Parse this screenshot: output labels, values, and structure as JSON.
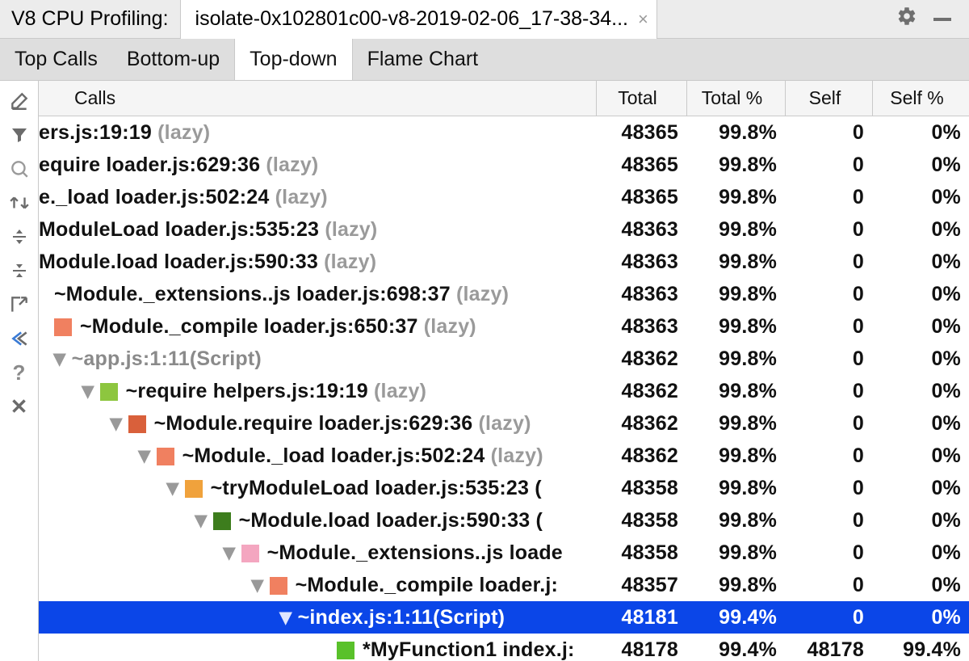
{
  "topbar": {
    "title": "V8 CPU Profiling:",
    "file_name": "isolate-0x102801c00-v8-2019-02-06_17-38-34...",
    "close_glyph": "×"
  },
  "tabs": {
    "items": [
      {
        "label": "Top Calls"
      },
      {
        "label": "Bottom-up"
      },
      {
        "label": "Top-down"
      },
      {
        "label": "Flame Chart"
      }
    ],
    "active_index": 2
  },
  "columns": {
    "calls": "Calls",
    "total": "Total",
    "total_pct": "Total %",
    "self": "Self",
    "self_pct": "Self %"
  },
  "rows": [
    {
      "indent": 0,
      "chev": false,
      "sq": null,
      "parts": [
        {
          "t": "ers.js:19:19 "
        },
        {
          "t": "(lazy)",
          "cls": "lazy"
        }
      ],
      "total": "48365",
      "totalp": "99.8%",
      "self": "0",
      "selfp": "0%"
    },
    {
      "indent": 0,
      "chev": false,
      "sq": null,
      "parts": [
        {
          "t": "equire loader.js:629:36 "
        },
        {
          "t": "(lazy)",
          "cls": "lazy"
        }
      ],
      "total": "48365",
      "totalp": "99.8%",
      "self": "0",
      "selfp": "0%"
    },
    {
      "indent": 0,
      "chev": false,
      "sq": null,
      "parts": [
        {
          "t": "e._load loader.js:502:24 "
        },
        {
          "t": "(lazy)",
          "cls": "lazy"
        }
      ],
      "total": "48365",
      "totalp": "99.8%",
      "self": "0",
      "selfp": "0%"
    },
    {
      "indent": 0,
      "chev": false,
      "sq": null,
      "parts": [
        {
          "t": "ModuleLoad loader.js:535:23 "
        },
        {
          "t": "(lazy)",
          "cls": "lazy"
        }
      ],
      "total": "48363",
      "totalp": "99.8%",
      "self": "0",
      "selfp": "0%"
    },
    {
      "indent": 0,
      "chev": false,
      "sq": null,
      "parts": [
        {
          "t": "Module.load loader.js:590:33 "
        },
        {
          "t": "(lazy)",
          "cls": "lazy"
        }
      ],
      "total": "48363",
      "totalp": "99.8%",
      "self": "0",
      "selfp": "0%"
    },
    {
      "indent": 19,
      "chev": false,
      "sq": null,
      "parts": [
        {
          "t": "~Module._extensions..js loader.js:698:37 "
        },
        {
          "t": "(lazy)",
          "cls": "lazy"
        }
      ],
      "total": "48363",
      "totalp": "99.8%",
      "self": "0",
      "selfp": "0%"
    },
    {
      "indent": 19,
      "chev": false,
      "sq": "#f08060",
      "parts": [
        {
          "t": "~Module._compile loader.js:650:37 "
        },
        {
          "t": "(lazy)",
          "cls": "lazy"
        }
      ],
      "total": "48363",
      "totalp": "99.8%",
      "self": "0",
      "selfp": "0%"
    },
    {
      "indent": 19,
      "chev": true,
      "sq": null,
      "parts": [
        {
          "t": "~app.js:1:11",
          "cls": "gray"
        },
        {
          "t": "(Script)",
          "cls": "gray"
        }
      ],
      "total": "48362",
      "totalp": "99.8%",
      "self": "0",
      "selfp": "0%"
    },
    {
      "indent": 54,
      "chev": true,
      "sq": "#8dc63f",
      "parts": [
        {
          "t": "~require helpers.js:19:19 "
        },
        {
          "t": "(lazy)",
          "cls": "lazy"
        }
      ],
      "total": "48362",
      "totalp": "99.8%",
      "self": "0",
      "selfp": "0%"
    },
    {
      "indent": 89,
      "chev": true,
      "sq": "#d9603b",
      "parts": [
        {
          "t": "~Module.require loader.js:629:36 "
        },
        {
          "t": "(lazy)",
          "cls": "lazy"
        }
      ],
      "total": "48362",
      "totalp": "99.8%",
      "self": "0",
      "selfp": "0%"
    },
    {
      "indent": 124,
      "chev": true,
      "sq": "#f08060",
      "parts": [
        {
          "t": "~Module._load loader.js:502:24 "
        },
        {
          "t": "(lazy)",
          "cls": "lazy"
        }
      ],
      "total": "48362",
      "totalp": "99.8%",
      "self": "0",
      "selfp": "0%"
    },
    {
      "indent": 159,
      "chev": true,
      "sq": "#f0a23c",
      "parts": [
        {
          "t": "~tryModuleLoad loader.js:535:23 ("
        }
      ],
      "total": "48358",
      "totalp": "99.8%",
      "self": "0",
      "selfp": "0%"
    },
    {
      "indent": 194,
      "chev": true,
      "sq": "#3d7d1d",
      "parts": [
        {
          "t": "~Module.load loader.js:590:33 ("
        }
      ],
      "total": "48358",
      "totalp": "99.8%",
      "self": "0",
      "selfp": "0%"
    },
    {
      "indent": 229,
      "chev": true,
      "sq": "#f4a6c0",
      "parts": [
        {
          "t": "~Module._extensions..js loade"
        }
      ],
      "total": "48358",
      "totalp": "99.8%",
      "self": "0",
      "selfp": "0%"
    },
    {
      "indent": 264,
      "chev": true,
      "sq": "#f08060",
      "parts": [
        {
          "t": "~Module._compile loader.j:"
        }
      ],
      "total": "48357",
      "totalp": "99.8%",
      "self": "0",
      "selfp": "0%"
    },
    {
      "indent": 299,
      "chev": true,
      "sq": null,
      "parts": [
        {
          "t": "~index.js:1:11(Script)"
        }
      ],
      "selected": true,
      "total": "48181",
      "totalp": "99.4%",
      "self": "0",
      "selfp": "0%"
    },
    {
      "indent": 369,
      "chev": false,
      "sq": "#59c12a",
      "parts": [
        {
          "t": "*MyFunction1 index.j:"
        }
      ],
      "total": "48178",
      "totalp": "99.4%",
      "self": "48178",
      "selfp": "99.4%"
    }
  ]
}
